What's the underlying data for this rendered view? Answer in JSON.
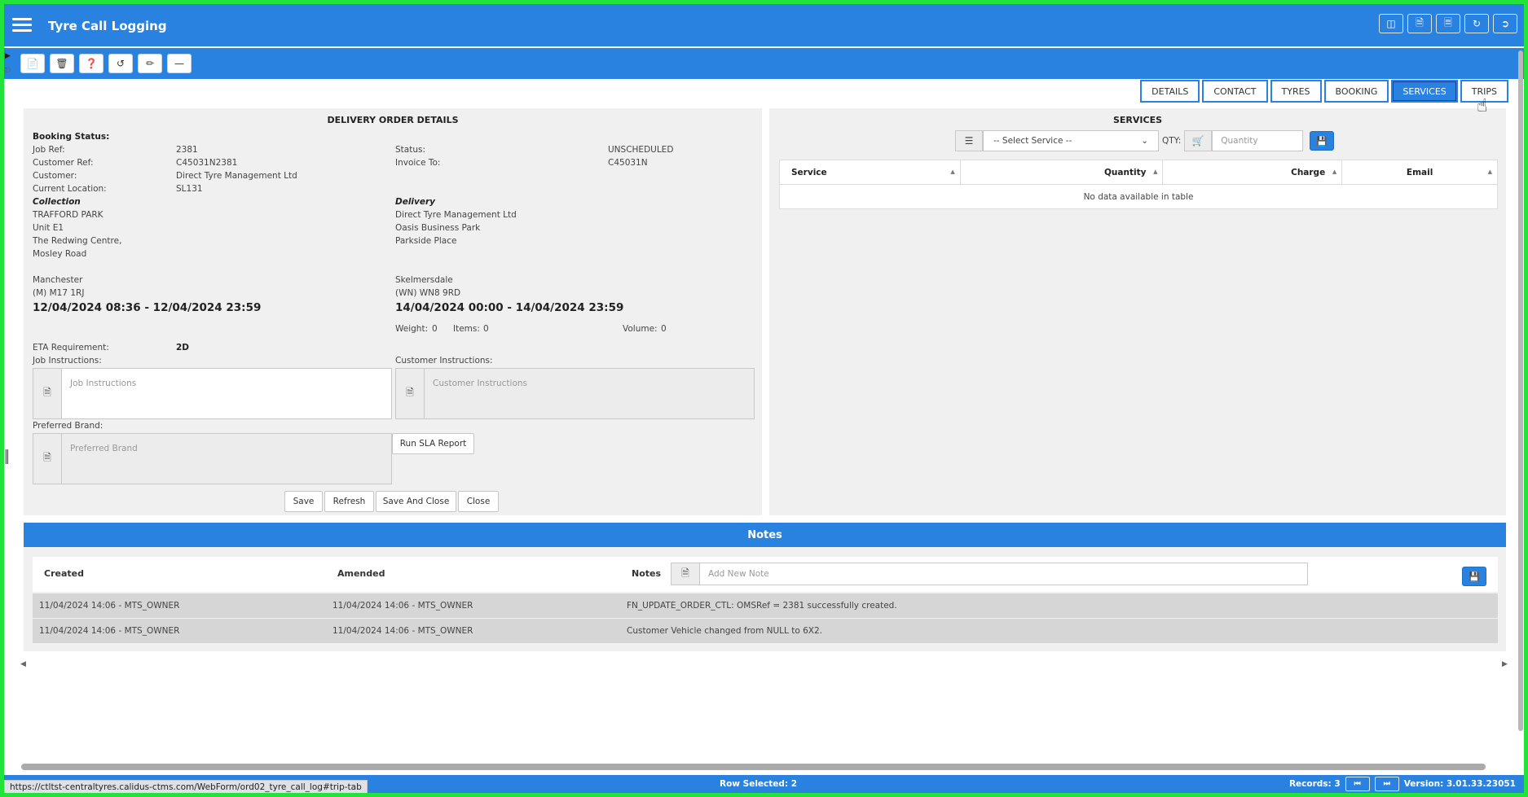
{
  "app": {
    "title": "Tyre Call Logging"
  },
  "tabs": [
    {
      "label": "DETAILS"
    },
    {
      "label": "CONTACT"
    },
    {
      "label": "TYRES"
    },
    {
      "label": "BOOKING"
    },
    {
      "label": "SERVICES"
    },
    {
      "label": "TRIPS"
    }
  ],
  "delivery": {
    "title": "DELIVERY ORDER DETAILS",
    "booking_status_label": "Booking Status:",
    "job_ref_label": "Job Ref:",
    "job_ref": "2381",
    "customer_ref_label": "Customer Ref:",
    "customer_ref": "C45031N2381",
    "customer_label": "Customer:",
    "customer": "Direct Tyre Management Ltd",
    "current_location_label": "Current Location:",
    "current_location": "SL131",
    "status_label": "Status:",
    "status": "UNSCHEDULED",
    "invoice_to_label": "Invoice To:",
    "invoice_to": "C45031N",
    "collection": {
      "heading": "Collection",
      "line1": "TRAFFORD PARK",
      "line2": "Unit E1",
      "line3": "The Redwing Centre,",
      "line4": "Mosley Road",
      "town": "Manchester",
      "postcode": "(M) M17 1RJ",
      "window": "12/04/2024 08:36 - 12/04/2024 23:59"
    },
    "delivery_addr": {
      "heading": "Delivery",
      "line1": "Direct Tyre Management Ltd",
      "line2": "Oasis Business Park",
      "line3": "Parkside Place",
      "town": "Skelmersdale",
      "postcode": "(WN) WN8 9RD",
      "window": "14/04/2024 00:00 - 14/04/2024 23:59"
    },
    "weight_label": "Weight:",
    "weight": "0",
    "items_label": "Items:",
    "items": "0",
    "volume_label": "Volume:",
    "volume": "0",
    "eta_label": "ETA Requirement:",
    "eta": "2D",
    "job_instructions_label": "Job Instructions:",
    "job_instructions_placeholder": "Job Instructions",
    "customer_instructions_label": "Customer Instructions:",
    "customer_instructions_placeholder": "Customer Instructions",
    "preferred_brand_label": "Preferred Brand:",
    "preferred_brand_placeholder": "Preferred Brand",
    "run_sla_label": "Run SLA Report",
    "buttons": {
      "save": "Save",
      "refresh": "Refresh",
      "save_close": "Save And Close",
      "close": "Close"
    }
  },
  "services": {
    "title": "SERVICES",
    "select_value": "-- Select Service --",
    "qty_label": "QTY:",
    "quantity_placeholder": "Quantity",
    "columns": [
      "Service",
      "Quantity",
      "Charge",
      "Email"
    ],
    "empty_text": "No data available in table"
  },
  "notes": {
    "title": "Notes",
    "col_created": "Created",
    "col_amended": "Amended",
    "col_notes": "Notes",
    "add_placeholder": "Add New Note",
    "rows": [
      {
        "created": "11/04/2024 14:06 - MTS_OWNER",
        "amended": "11/04/2024 14:06 - MTS_OWNER",
        "note": "FN_UPDATE_ORDER_CTL: OMSRef = 2381 successfully created."
      },
      {
        "created": "11/04/2024 14:06 - MTS_OWNER",
        "amended": "11/04/2024 14:06 - MTS_OWNER",
        "note": "Customer Vehicle changed from NULL to 6X2."
      }
    ]
  },
  "statusbar": {
    "url": "https://ctltst-centraltyres.calidus-ctms.com/WebForm/ord02_tyre_call_log#trip-tab",
    "row_selected": "Row Selected: 2",
    "records": "Records: 3",
    "version": "Version: 3.01.33.23051"
  },
  "colors": {
    "primary": "#2a82e0",
    "frame": "#22e33a",
    "panel": "#f0f0f0"
  }
}
